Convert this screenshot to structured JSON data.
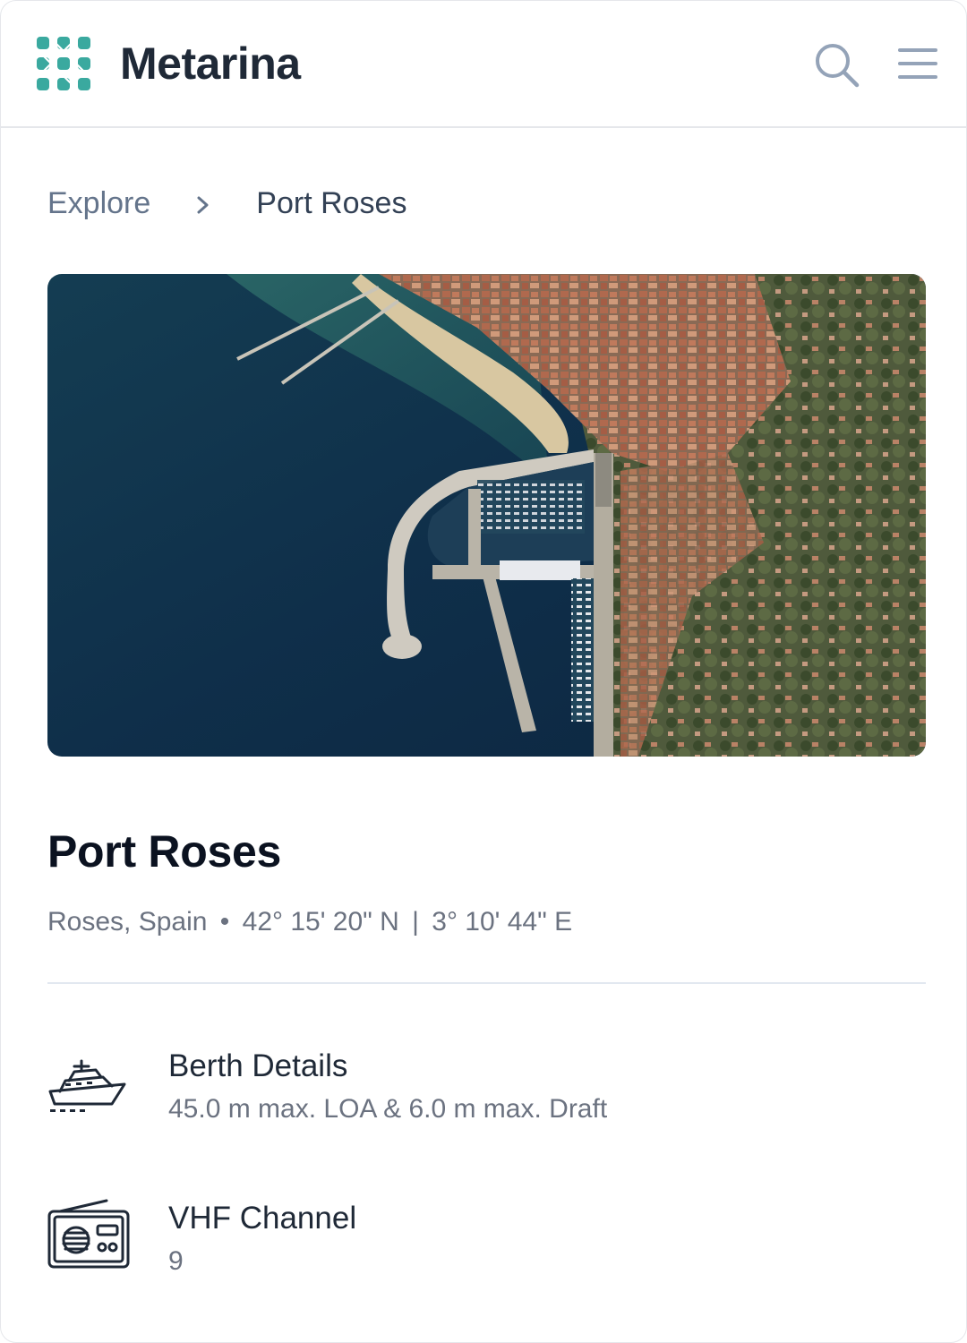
{
  "header": {
    "brand": "Metarina",
    "icons": {
      "logo": "grid-logo-icon",
      "search": "search-icon",
      "menu": "hamburger-menu-icon"
    },
    "colors": {
      "brand_teal": "#3aa99f",
      "icon_gray": "#94a3b8"
    }
  },
  "breadcrumb": {
    "parent": "Explore",
    "current": "Port Roses",
    "separator_icon": "chevron-right-icon"
  },
  "hero": {
    "icon": "aerial-satellite-photo"
  },
  "marina": {
    "name": "Port Roses",
    "location": "Roses, Spain",
    "bullet": "•",
    "lat": "42° 15' 20\" N",
    "coord_separator": "|",
    "lon": "3° 10' 44\" E"
  },
  "details": [
    {
      "icon": "yacht-icon",
      "label": "Berth Details",
      "value": "45.0 m max. LOA & 6.0 m max. Draft"
    },
    {
      "icon": "radio-icon",
      "label": "VHF Channel",
      "value": "9"
    }
  ]
}
